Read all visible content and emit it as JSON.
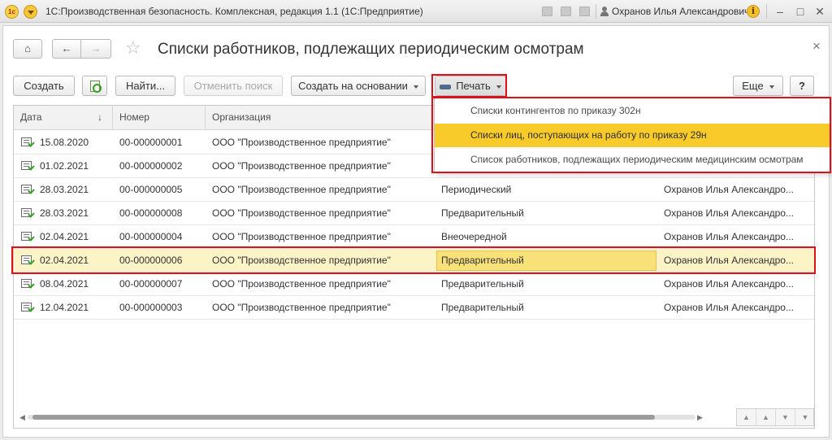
{
  "titlebar": {
    "logo_text": "1c",
    "app_title": "1С:Производственная безопасность. Комплексная, редакция 1.1  (1С:Предприятие)",
    "user_name": "Охранов Илья Александрович",
    "info_label": "i"
  },
  "window_controls": {
    "minimize": "–",
    "maximize": "□",
    "close": "✕"
  },
  "form": {
    "home": "⌂",
    "back": "←",
    "forward": "→",
    "star": "☆",
    "title": "Списки работников, подлежащих периодическим осмотрам",
    "close": "×"
  },
  "toolbar": {
    "create": "Создать",
    "find": "Найти...",
    "cancel_search": "Отменить поиск",
    "create_based": "Создать на основании",
    "print": "Печать",
    "more": "Еще",
    "help": "?"
  },
  "table": {
    "columns": [
      "Дата",
      "Номер",
      "Организация"
    ],
    "sort_indicator": "↓",
    "rows": [
      {
        "date": "15.08.2020",
        "number": "00-000000001",
        "org": "ООО \"Производственное предприятие\"",
        "type": "",
        "responsible": ""
      },
      {
        "date": "01.02.2021",
        "number": "00-000000002",
        "org": "ООО \"Производственное предприятие\"",
        "type": "",
        "responsible": ""
      },
      {
        "date": "28.03.2021",
        "number": "00-000000005",
        "org": "ООО \"Производственное предприятие\"",
        "type": "Периодический",
        "responsible": "Охранов Илья Александро..."
      },
      {
        "date": "28.03.2021",
        "number": "00-000000008",
        "org": "ООО \"Производственное предприятие\"",
        "type": "Предварительный",
        "responsible": "Охранов Илья Александро..."
      },
      {
        "date": "02.04.2021",
        "number": "00-000000004",
        "org": "ООО \"Производственное предприятие\"",
        "type": "Внеочередной",
        "responsible": "Охранов Илья Александро..."
      },
      {
        "date": "02.04.2021",
        "number": "00-000000006",
        "org": "ООО \"Производственное предприятие\"",
        "type": "Предварительный",
        "responsible": "Охранов Илья Александро..."
      },
      {
        "date": "08.04.2021",
        "number": "00-000000007",
        "org": "ООО \"Производственное предприятие\"",
        "type": "Предварительный",
        "responsible": "Охранов Илья Александро..."
      },
      {
        "date": "12.04.2021",
        "number": "00-000000003",
        "org": "ООО \"Производственное предприятие\"",
        "type": "Предварительный",
        "responsible": "Охранов Илья Александро..."
      }
    ],
    "selected_row_index": 5
  },
  "print_menu": {
    "items": [
      "Списки контингентов по приказу 302н",
      "Списки лиц, поступающих на работу по приказу 29н",
      "Список работников, подлежащих периодическим медицинским осмотрам"
    ],
    "highlighted_index": 1
  },
  "scroll": {
    "left": "◀",
    "right": "▶"
  },
  "nav_arrows": [
    "▲",
    "▲",
    "▼",
    "▼"
  ],
  "colors": {
    "selected_row": "#fcf3c6",
    "menu_highlight": "#f8cb2b",
    "annotation_red": "#e0101a"
  }
}
